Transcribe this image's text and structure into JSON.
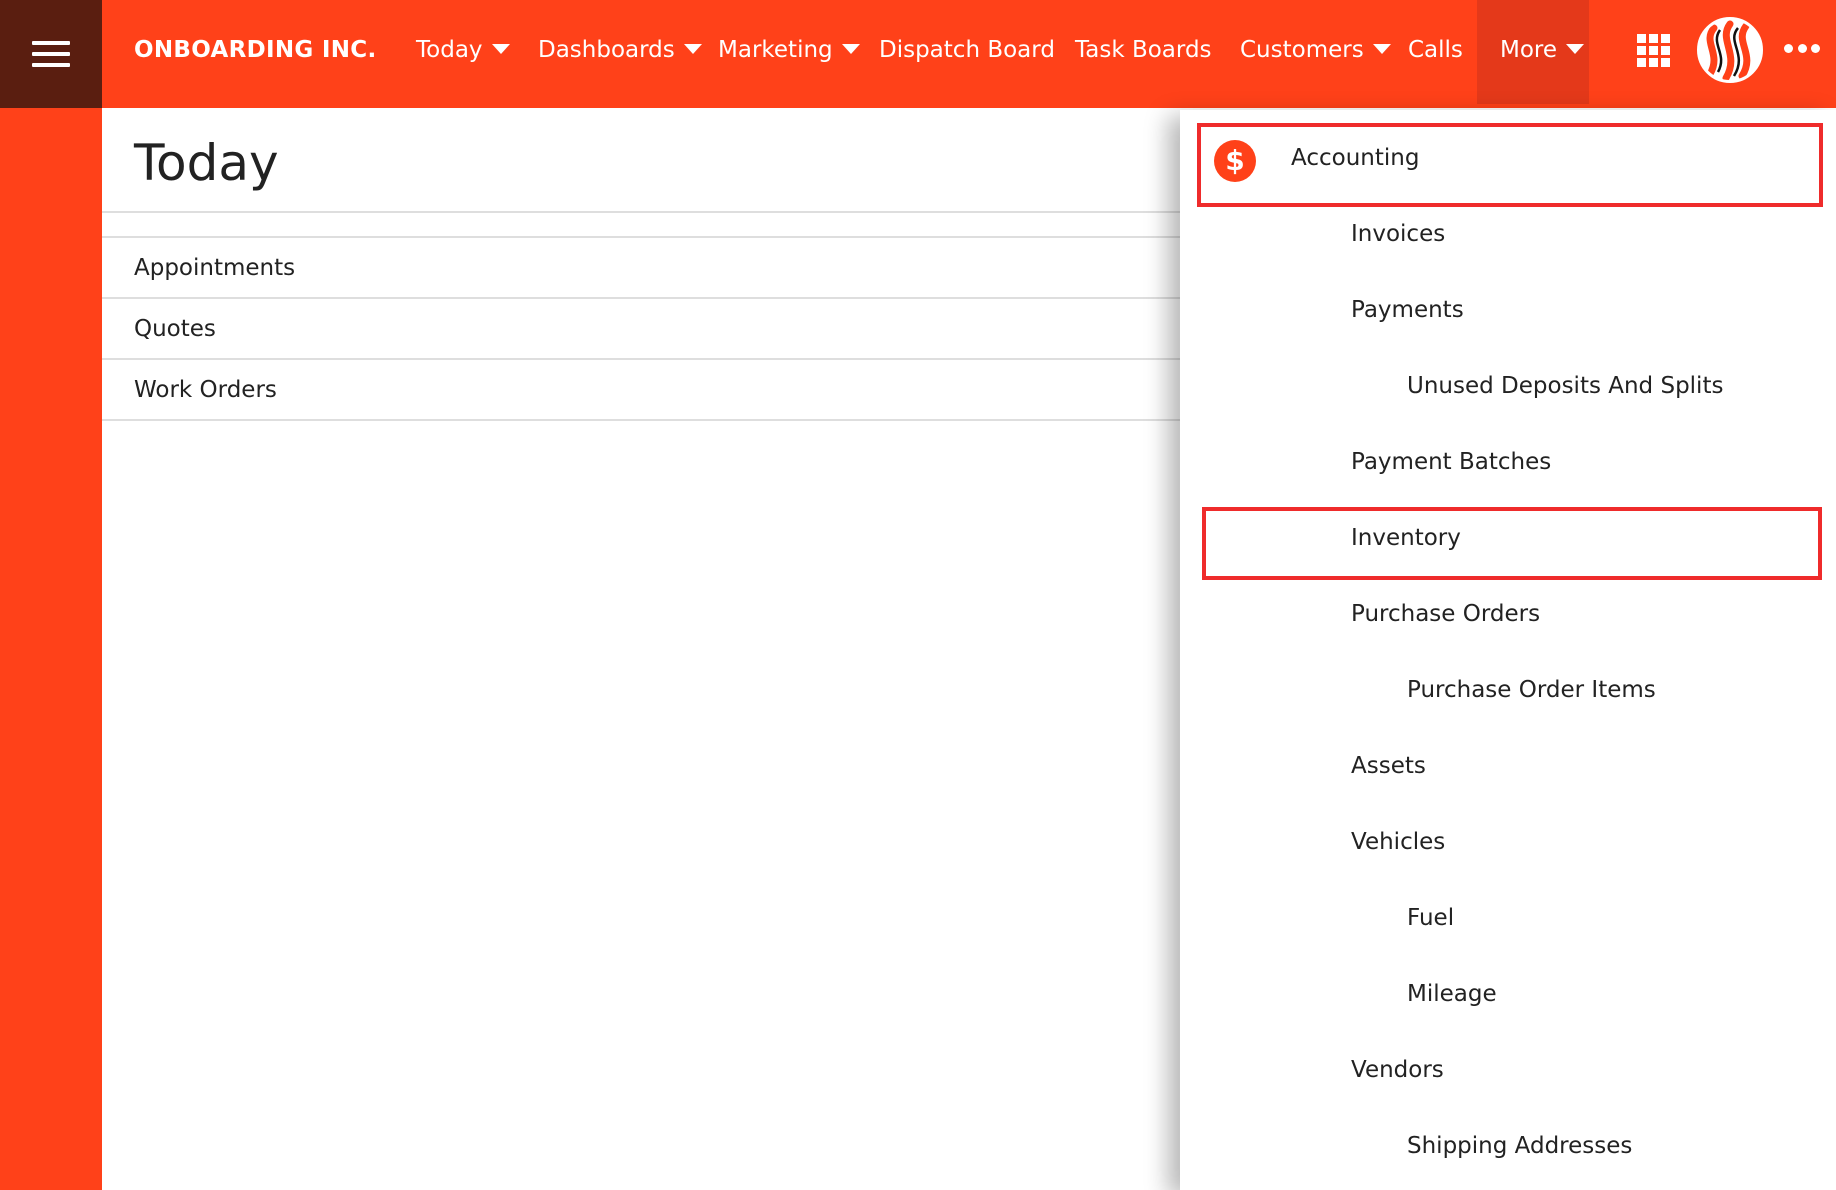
{
  "topbar": {
    "brand": "ONBOARDING INC.",
    "nav": [
      {
        "label": "Today",
        "dropdown": true
      },
      {
        "label": "Dashboards",
        "dropdown": true
      },
      {
        "label": "Marketing",
        "dropdown": true
      },
      {
        "label": "Dispatch Board",
        "dropdown": false
      },
      {
        "label": "Task Boards",
        "dropdown": false
      },
      {
        "label": "Customers",
        "dropdown": true
      },
      {
        "label": "Calls",
        "dropdown": false
      },
      {
        "label": "More",
        "dropdown": true,
        "active": true
      }
    ],
    "icons": [
      "hamburger-menu-icon",
      "apps-grid-icon",
      "user-avatar",
      "more-options-icon"
    ]
  },
  "page": {
    "title": "Today",
    "rows": [
      "Appointments",
      "Quotes",
      "Work Orders"
    ]
  },
  "menu": {
    "section_icon": "dollar-icon",
    "items": [
      {
        "label": "Accounting",
        "level": 0,
        "highlighted": true
      },
      {
        "label": "Invoices",
        "level": 1
      },
      {
        "label": "Payments",
        "level": 1
      },
      {
        "label": "Unused Deposits And Splits",
        "level": 2
      },
      {
        "label": "Payment Batches",
        "level": 1
      },
      {
        "label": "Inventory",
        "level": 1,
        "highlighted": true
      },
      {
        "label": "Purchase Orders",
        "level": 1
      },
      {
        "label": "Purchase Order Items",
        "level": 2
      },
      {
        "label": "Assets",
        "level": 1
      },
      {
        "label": "Vehicles",
        "level": 1
      },
      {
        "label": "Fuel",
        "level": 2
      },
      {
        "label": "Mileage",
        "level": 2
      },
      {
        "label": "Vendors",
        "level": 1
      },
      {
        "label": "Shipping Addresses",
        "level": 2
      }
    ]
  },
  "colors": {
    "brand": "#ff4119",
    "hamburger_bg": "#5a1e10",
    "more_active_bg": "#e4391a",
    "highlight_border": "#ef2b2b"
  }
}
